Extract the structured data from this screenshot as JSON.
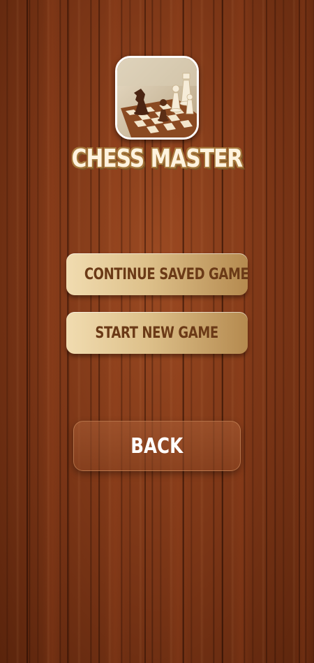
{
  "app": {
    "title": "CHESS MASTER"
  },
  "menu": {
    "continue_label": "CONTINUE SAVED GAME",
    "new_game_label": "START NEW GAME",
    "back_label": "BACK"
  },
  "icons": {
    "logo": "chess-board-logo-icon"
  },
  "colors": {
    "wood_background": "#7a3516",
    "button_gold_light": "#f1dcb0",
    "button_gold_dark": "#b58a4f",
    "button_text": "#6b3a17",
    "title_text": "#fff3de",
    "title_outline": "#a6793e"
  }
}
